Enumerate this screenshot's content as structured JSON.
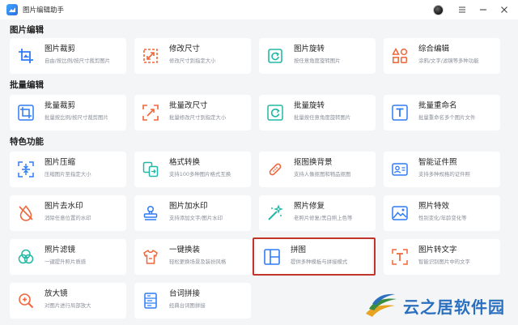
{
  "app": {
    "title": "图片编辑助手"
  },
  "window": {
    "minimize": "—",
    "maximize": "☐",
    "close": "✕"
  },
  "sections": {
    "image_edit": "图片编辑",
    "batch_edit": "批量编辑",
    "features": "特色功能"
  },
  "cards": {
    "crop": {
      "name": "图片裁剪",
      "desc": "自由/按比例/按尺寸裁剪图片",
      "icon": "crop-icon"
    },
    "resize": {
      "name": "修改尺寸",
      "desc": "修改尺寸到指定大小",
      "icon": "resize-icon"
    },
    "rotate": {
      "name": "图片旋转",
      "desc": "按任意角度旋转图片",
      "icon": "rotate-icon"
    },
    "combined": {
      "name": "综合编辑",
      "desc": "涂鸦/文字/滤镜等多种功能",
      "icon": "shapes-icon"
    },
    "batch_crop": {
      "name": "批量裁剪",
      "desc": "批量按比例/按尺寸裁剪图片",
      "icon": "batch-crop-icon"
    },
    "batch_resize": {
      "name": "批量改尺寸",
      "desc": "批量修改尺寸到指定大小",
      "icon": "batch-resize-icon"
    },
    "batch_rotate": {
      "name": "批量旋转",
      "desc": "批量按任意角度旋转图片",
      "icon": "batch-rotate-icon"
    },
    "batch_rename": {
      "name": "批量重命名",
      "desc": "批量重命名多个图片文件",
      "icon": "text-icon"
    },
    "compress": {
      "name": "图片压缩",
      "desc": "压缩图片至指定大小",
      "icon": "compress-icon"
    },
    "convert": {
      "name": "格式转换",
      "desc": "支持100多种图片格式互换",
      "icon": "convert-icon"
    },
    "matting": {
      "name": "抠图换背景",
      "desc": "支持人像抠图和物品抠图",
      "icon": "matting-icon"
    },
    "id_photo": {
      "name": "智能证件照",
      "desc": "支持多种规格的证件照",
      "icon": "id-photo-icon"
    },
    "remove_watermark": {
      "name": "图片去水印",
      "desc": "消除任意位置的水印",
      "icon": "drop-icon"
    },
    "add_watermark": {
      "name": "图片加水印",
      "desc": "支持添加文字/图片水印",
      "icon": "stamp-icon"
    },
    "repair": {
      "name": "照片修复",
      "desc": "老照片修复/黑白照上色等",
      "icon": "magic-wand-icon"
    },
    "effects": {
      "name": "照片特效",
      "desc": "性别变化/年龄变化等",
      "icon": "landscape-icon"
    },
    "filter": {
      "name": "照片滤镜",
      "desc": "一键提升照片质感",
      "icon": "filter-icon"
    },
    "outfit": {
      "name": "一键换装",
      "desc": "轻松更换场景及装扮风格",
      "icon": "shirt-icon"
    },
    "collage": {
      "name": "拼图",
      "desc": "提供多种模板与拼接模式",
      "icon": "collage-icon"
    },
    "ocr": {
      "name": "图片转文字",
      "desc": "智能识别图片中的文字",
      "icon": "ocr-icon"
    },
    "magnifier": {
      "name": "放大镜",
      "desc": "对图片进行局部放大",
      "icon": "magnifier-icon"
    },
    "stitch": {
      "name": "台词拼接",
      "desc": "经典台词图拼接",
      "icon": "stitch-icon"
    }
  },
  "colors": {
    "accent_blue": "#2f7cf6",
    "accent_orange": "#f0653a",
    "accent_teal": "#22b8a6",
    "highlight_red": "#c0362c"
  },
  "watermark": {
    "text": "云之居软件园"
  }
}
